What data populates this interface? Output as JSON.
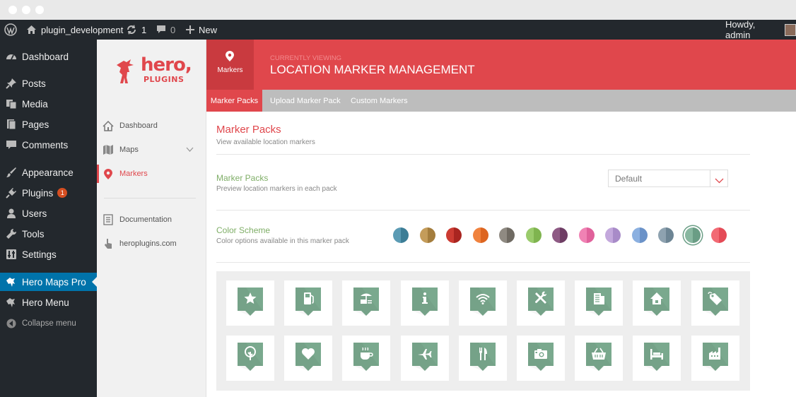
{
  "adminbar": {
    "site_name": "plugin_development",
    "updates_count": "1",
    "comments_count": "0",
    "new_label": "New",
    "greeting": "Howdy, admin"
  },
  "sidebar": {
    "items": [
      {
        "label": "Dashboard",
        "icon": "dashboard-icon"
      },
      {
        "label": "Posts",
        "icon": "pin-icon"
      },
      {
        "label": "Media",
        "icon": "media-icon"
      },
      {
        "label": "Pages",
        "icon": "pages-icon"
      },
      {
        "label": "Comments",
        "icon": "comment-icon"
      },
      {
        "label": "Appearance",
        "icon": "brush-icon"
      },
      {
        "label": "Plugins",
        "icon": "plug-icon",
        "badge": "1"
      },
      {
        "label": "Users",
        "icon": "user-icon"
      },
      {
        "label": "Tools",
        "icon": "wrench-icon"
      },
      {
        "label": "Settings",
        "icon": "settings-icon"
      },
      {
        "label": "Hero Maps Pro",
        "icon": "hero-icon"
      },
      {
        "label": "Hero Menu",
        "icon": "hero-icon"
      },
      {
        "label": "Collapse menu",
        "icon": "collapse-icon"
      }
    ]
  },
  "logo": {
    "line1": "hero,",
    "line2": "PLUGINS"
  },
  "plugin_nav": {
    "items": [
      {
        "label": "Dashboard",
        "icon": "home-icon"
      },
      {
        "label": "Maps",
        "icon": "map-icon"
      },
      {
        "label": "Markers",
        "icon": "location-pin-icon"
      },
      {
        "label": "Documentation",
        "icon": "document-icon"
      },
      {
        "label": "heroplugins.com",
        "icon": "pointer-icon"
      }
    ]
  },
  "header": {
    "section_label": "Markers",
    "eyebrow": "CURRENTLY VIEWING",
    "title": "LOCATION MARKER MANAGEMENT"
  },
  "tabs": [
    {
      "label": "Marker Packs",
      "active": true
    },
    {
      "label": "Upload Marker Pack",
      "active": false
    },
    {
      "label": "Custom Markers",
      "active": false
    }
  ],
  "content": {
    "title": "Marker Packs",
    "subtitle": "View available location markers",
    "pack_section": {
      "title": "Marker Packs",
      "subtitle": "Preview location markers in each pack",
      "selected": "Default"
    },
    "color_section": {
      "title": "Color Scheme",
      "subtitle": "Color options available in this marker pack"
    }
  },
  "colors": {
    "accent": "#e0474c",
    "wp_dark": "#23282d",
    "wp_blue": "#0073aa",
    "marker_green": "#7aa98e"
  },
  "swatches": [
    {
      "light": "#5b9bb4",
      "dark": "#3c7d96"
    },
    {
      "light": "#c49c5a",
      "dark": "#a47d3d"
    },
    {
      "light": "#cc3b32",
      "dark": "#a92520"
    },
    {
      "light": "#f0823e",
      "dark": "#dd6520"
    },
    {
      "light": "#8f8a82",
      "dark": "#6f6a62"
    },
    {
      "light": "#9acb6c",
      "dark": "#7fb44f"
    },
    {
      "light": "#8e5a84",
      "dark": "#6e3d64"
    },
    {
      "light": "#f082b4",
      "dark": "#e0619b"
    },
    {
      "light": "#c3a8dc",
      "dark": "#a88bc8"
    },
    {
      "light": "#8bb0e0",
      "dark": "#6b92c8"
    },
    {
      "light": "#8ea2b0",
      "dark": "#6d8594"
    },
    {
      "light": "#88b7a0",
      "dark": "#6a9d85",
      "selected": true
    },
    {
      "light": "#f26a74",
      "dark": "#e44b57"
    }
  ],
  "markers": [
    "star-icon",
    "fuel-icon",
    "atm-icon",
    "info-icon",
    "wifi-icon",
    "repair-icon",
    "building-icon",
    "home-icon",
    "tag-icon",
    "tree-icon",
    "heart-icon",
    "coffee-icon",
    "airplane-icon",
    "restaurant-icon",
    "camera-icon",
    "basket-icon",
    "hotel-icon",
    "factory-icon"
  ]
}
